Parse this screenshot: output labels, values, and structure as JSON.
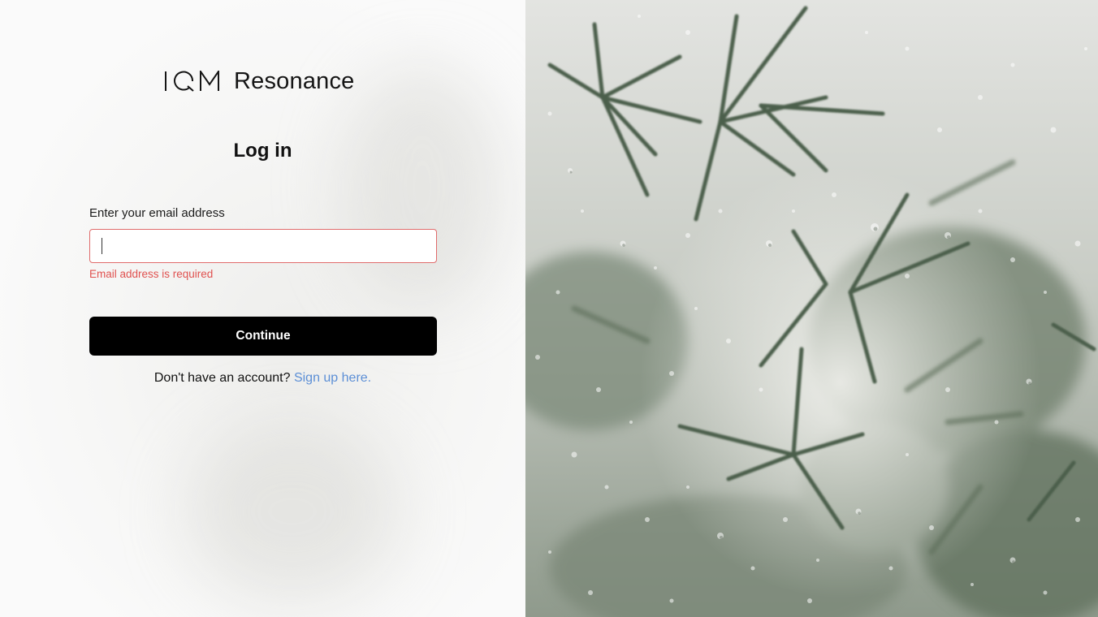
{
  "brand": {
    "logo_mark": "IQM",
    "name": "Resonance"
  },
  "login": {
    "title": "Log in",
    "email_label": "Enter your email address",
    "email_value": "",
    "email_placeholder": "",
    "error": "Email address is required",
    "continue_label": "Continue",
    "signup_prompt": "Don't have an account?",
    "signup_link": "Sign up here."
  },
  "colors": {
    "error": "#e0514f",
    "link": "#5c8fd6",
    "button_bg": "#000000",
    "foliage": "#4c5e4b"
  },
  "hero_image": {
    "description_icon": "rainy-foliage-image"
  }
}
